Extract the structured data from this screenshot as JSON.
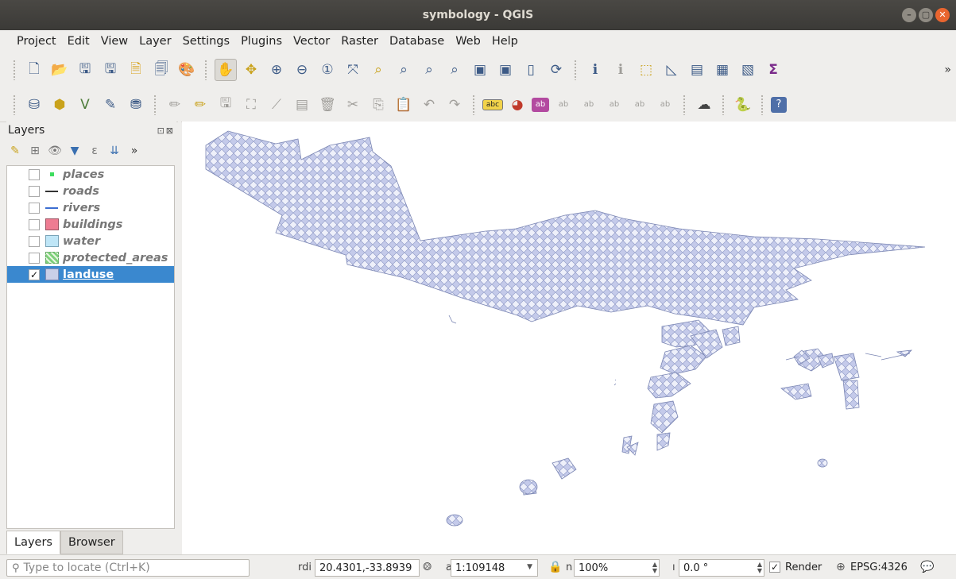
{
  "window": {
    "title": "symbology - QGIS",
    "controls": [
      "–",
      "▢",
      "✕"
    ]
  },
  "menubar": {
    "items": [
      {
        "label": "Project"
      },
      {
        "label": "Edit"
      },
      {
        "label": "View"
      },
      {
        "label": "Layer"
      },
      {
        "label": "Settings"
      },
      {
        "label": "Plugins"
      },
      {
        "label": "Vector"
      },
      {
        "label": "Raster"
      },
      {
        "label": "Database"
      },
      {
        "label": "Web"
      },
      {
        "label": "Help"
      }
    ]
  },
  "toolbar1": {
    "overflow": "»",
    "icons": [
      {
        "name": "new-project-icon",
        "glyph": "🗋"
      },
      {
        "name": "open-project-icon",
        "glyph": "📂"
      },
      {
        "name": "save-project-icon",
        "glyph": "🖫"
      },
      {
        "name": "save-as-icon",
        "glyph": "🖫"
      },
      {
        "name": "new-print-layout-icon",
        "glyph": "🗎"
      },
      {
        "name": "layout-manager-icon",
        "glyph": "🗐"
      },
      {
        "name": "style-manager-icon",
        "glyph": "🎨"
      },
      {
        "name": "pan-map-icon",
        "glyph": "✋"
      },
      {
        "name": "pan-to-selection-icon",
        "glyph": "✥"
      },
      {
        "name": "zoom-in-icon",
        "glyph": "⊕"
      },
      {
        "name": "zoom-out-icon",
        "glyph": "⊖"
      },
      {
        "name": "zoom-native-icon",
        "glyph": "①"
      },
      {
        "name": "zoom-full-icon",
        "glyph": "⤧"
      },
      {
        "name": "zoom-to-selection-icon",
        "glyph": "⌕"
      },
      {
        "name": "zoom-to-layer-icon",
        "glyph": "⌕"
      },
      {
        "name": "zoom-last-icon",
        "glyph": "⌕"
      },
      {
        "name": "zoom-next-icon",
        "glyph": "⌕"
      },
      {
        "name": "new-map-view-icon",
        "glyph": "▣"
      },
      {
        "name": "new-3d-map-view-icon",
        "glyph": "▣"
      },
      {
        "name": "new-bookmark-icon",
        "glyph": "▯"
      },
      {
        "name": "refresh-icon",
        "glyph": "⟳"
      },
      {
        "name": "identify-features-icon",
        "glyph": "ℹ"
      },
      {
        "name": "map-tips-icon",
        "glyph": "ℹ"
      },
      {
        "name": "select-features-icon",
        "glyph": "⬚"
      },
      {
        "name": "deselect-features-icon",
        "glyph": "◺"
      },
      {
        "name": "select-by-expression-icon",
        "glyph": "▤"
      },
      {
        "name": "attribute-table-icon",
        "glyph": "▦"
      },
      {
        "name": "field-calculator-icon",
        "glyph": "▧"
      },
      {
        "name": "statistics-summary-icon",
        "glyph": "Σ"
      }
    ]
  },
  "toolbar2": {
    "icons": [
      {
        "name": "data-source-manager-icon",
        "glyph": "⛁"
      },
      {
        "name": "new-geopackage-layer-icon",
        "glyph": "⬢"
      },
      {
        "name": "new-shapefile-layer-icon",
        "glyph": "V"
      },
      {
        "name": "new-temporary-layer-icon",
        "glyph": "✎"
      },
      {
        "name": "new-virtual-layer-icon",
        "glyph": "⛃"
      },
      {
        "name": "current-edits-icon",
        "glyph": "✏"
      },
      {
        "name": "toggle-editing-icon",
        "glyph": "✏"
      },
      {
        "name": "save-layer-edits-icon",
        "glyph": "🖫"
      },
      {
        "name": "digitize-icon",
        "glyph": "⛶"
      },
      {
        "name": "vertex-tool-icon",
        "glyph": "⟋"
      },
      {
        "name": "modify-attributes-icon",
        "glyph": "▤"
      },
      {
        "name": "delete-selected-icon",
        "glyph": "🗑"
      },
      {
        "name": "cut-features-icon",
        "glyph": "✂"
      },
      {
        "name": "copy-features-icon",
        "glyph": "⎘"
      },
      {
        "name": "paste-features-icon",
        "glyph": "📋"
      },
      {
        "name": "undo-icon",
        "glyph": "↶"
      },
      {
        "name": "redo-icon",
        "glyph": "↷"
      },
      {
        "name": "layer-labeling-icon",
        "glyph": "abc"
      },
      {
        "name": "layer-diagram-icon",
        "glyph": "◕"
      },
      {
        "name": "pin-labels-icon",
        "glyph": "ab"
      },
      {
        "name": "highlight-pinned-labels-icon",
        "glyph": "ab"
      },
      {
        "name": "show-hide-labels-icon",
        "glyph": "ab"
      },
      {
        "name": "move-label-icon",
        "glyph": "ab"
      },
      {
        "name": "rotate-label-icon",
        "glyph": "ab"
      },
      {
        "name": "change-label-icon",
        "glyph": "ab"
      },
      {
        "name": "quickosm-icon",
        "glyph": "☁"
      },
      {
        "name": "python-console-icon",
        "glyph": "🐍"
      },
      {
        "name": "help-icon",
        "glyph": "?"
      }
    ]
  },
  "layers_panel": {
    "title": "Layers",
    "header_buttons": "⊡⊠",
    "toolbar_overflow": "»",
    "toolbar_icons": [
      {
        "name": "open-layer-styling-icon",
        "glyph": "✎"
      },
      {
        "name": "add-group-icon",
        "glyph": "⊞"
      },
      {
        "name": "manage-map-themes-icon",
        "glyph": "👁"
      },
      {
        "name": "filter-legend-icon",
        "glyph": "▼"
      },
      {
        "name": "filter-by-expression-icon",
        "glyph": "ε"
      },
      {
        "name": "expand-all-icon",
        "glyph": "⇊"
      }
    ],
    "layers": [
      {
        "name": "places",
        "checked": false,
        "symbol": "sym-point",
        "active": false
      },
      {
        "name": "roads",
        "checked": false,
        "symbol": "sym-line-roads",
        "active": false
      },
      {
        "name": "rivers",
        "checked": false,
        "symbol": "sym-line-rivers",
        "active": false
      },
      {
        "name": "buildings",
        "checked": false,
        "symbol": "sym-fill-buildings",
        "active": false
      },
      {
        "name": "water",
        "checked": false,
        "symbol": "sym-fill-water",
        "active": false
      },
      {
        "name": "protected_areas",
        "checked": false,
        "symbol": "sym-fill-protected",
        "active": false
      },
      {
        "name": "landuse",
        "checked": true,
        "symbol": "sym-fill-landuse",
        "active": true
      }
    ],
    "tabs": [
      {
        "label": "Layers",
        "active": true
      },
      {
        "label": "Browser",
        "active": false
      }
    ]
  },
  "statusbar": {
    "locator_placeholder": "Type to locate (Ctrl+K)",
    "coord_label": "rdi",
    "coordinate": "20.4301,-33.8939",
    "scale_label": "a",
    "scale": "1:109148",
    "magnifier_label": "n",
    "magnifier": "100%",
    "rotation_label": "ı",
    "rotation": "0.0 °",
    "render_label": "Render",
    "render_checked": true,
    "crs": "EPSG:4326"
  },
  "colors": {
    "selection": "#3a88cf",
    "titlebar": "#3b3a37",
    "landuse_fill": "#c7cdea",
    "landuse_stroke": "#7b86b3"
  }
}
